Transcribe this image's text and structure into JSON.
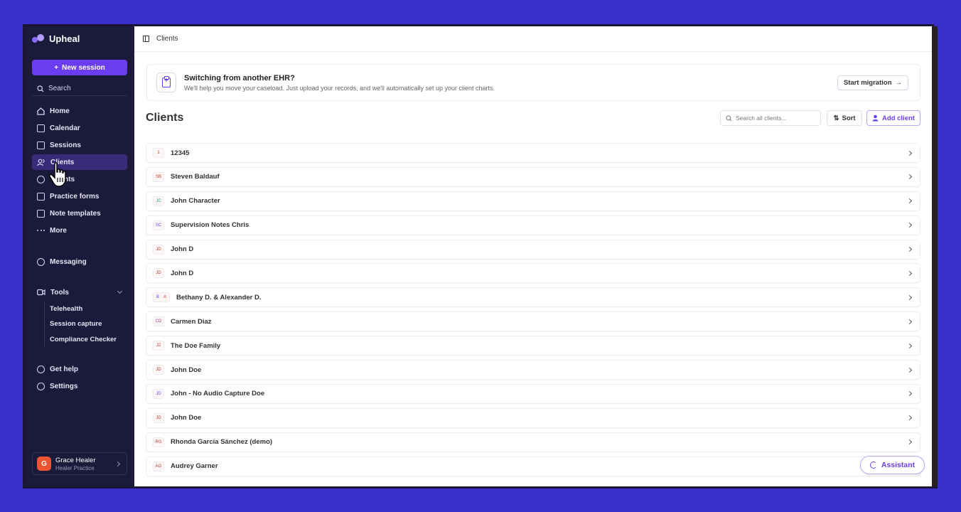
{
  "brand": {
    "name": "Upheal"
  },
  "sidebar": {
    "new_session": "New session",
    "search": "Search",
    "items": [
      {
        "label": "Home",
        "icon": "home-icon"
      },
      {
        "label": "Calendar",
        "icon": "calendar-icon"
      },
      {
        "label": "Sessions",
        "icon": "sessions-icon"
      },
      {
        "label": "Clients",
        "icon": "clients-icon"
      },
      {
        "label": "nts",
        "icon": "dollar-icon"
      },
      {
        "label": "Practice forms",
        "icon": "forms-icon"
      },
      {
        "label": "Note templates",
        "icon": "templates-icon"
      },
      {
        "label": "More",
        "icon": "more-icon"
      }
    ],
    "messaging": "Messaging",
    "tools": {
      "label": "Tools",
      "sub": [
        "Telehealth",
        "Session capture",
        "Compliance Checker"
      ]
    },
    "help": "Get help",
    "settings": "Settings",
    "user": {
      "initial": "G",
      "name": "Grace Healer",
      "practice": "Healer Practice"
    }
  },
  "topbar": {
    "breadcrumb": "Clients"
  },
  "banner": {
    "title": "Switching from another EHR?",
    "subtitle": "We'll help you move your caseload. Just upload your records, and we'll automatically set up your client charts.",
    "button": "Start migration",
    "button_arrow": "→"
  },
  "main": {
    "title": "Clients",
    "search_placeholder": "Search all clients...",
    "sort": "Sort",
    "add_client": "Add client"
  },
  "clients": [
    {
      "initials": "1",
      "name": "12345",
      "color": "#c0392b"
    },
    {
      "initials": "SB",
      "name": "Steven Baldauf",
      "color": "#c0392b"
    },
    {
      "initials": "JC",
      "name": "John Character",
      "color": "#17a589"
    },
    {
      "initials": "SC",
      "name": "Supervision Notes Chris",
      "color": "#5b4de0"
    },
    {
      "initials": "JD",
      "name": "John D",
      "color": "#c0392b"
    },
    {
      "initials": "JD",
      "name": "John D",
      "color": "#c0392b"
    },
    {
      "initials": "B",
      "initials2": "A",
      "name": "Bethany D. & Alexander D.",
      "color": "#5b4de0",
      "color2": "#c0392b"
    },
    {
      "initials": "CD",
      "name": "Carmen Diaz",
      "color": "#a93287"
    },
    {
      "initials": "J2",
      "name": "The Doe Family",
      "color": "#c0392b"
    },
    {
      "initials": "JD",
      "name": "John Doe",
      "color": "#c0392b"
    },
    {
      "initials": "JD",
      "name": "John - No Audio Capture Doe",
      "color": "#5b4de0"
    },
    {
      "initials": "JD",
      "name": "John Doe",
      "color": "#c0392b"
    },
    {
      "initials": "RG",
      "name": "Rhonda García Sánchez (demo)",
      "color": "#c0392b"
    },
    {
      "initials": "AG",
      "name": "Audrey Garner",
      "color": "#c0392b"
    }
  ],
  "assistant": "Assistant",
  "colors": {
    "accent": "#6b3df0",
    "sidebar_bg": "#1b1a3a",
    "background": "#3a2fc9"
  }
}
